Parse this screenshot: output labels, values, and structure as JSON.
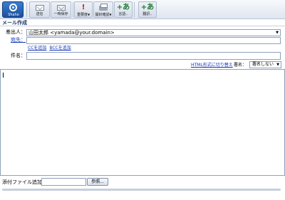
{
  "toolbar": {
    "logo_text": "Shaho",
    "buttons": [
      {
        "label": "送信",
        "icon": "send-icon"
      },
      {
        "label": "一時保存",
        "icon": "save-draft-icon"
      },
      {
        "label": "重要度",
        "icon": "priority-icon"
      },
      {
        "label": "開封確認",
        "icon": "read-receipt-icon"
      },
      {
        "label": "言語..",
        "icon": "language-icon"
      },
      {
        "label": "翻訳..",
        "icon": "translate-icon"
      }
    ]
  },
  "compose": {
    "title": "メール作成",
    "from_label": "差出人：",
    "from_value": "山田太郎 <yamada@your.domain>",
    "to_label": "宛先：",
    "cc_link": "CCを追加",
    "bcc_link": "BCCを追加",
    "subject_label": "件名：",
    "subject_value": "",
    "html_toggle": "HTML形式に切り替え",
    "signature_label": "署名：",
    "signature_value": "署名しない",
    "body_value": ""
  },
  "attachment": {
    "label": "添付ファイル追加：",
    "browse_label": "参照..."
  }
}
